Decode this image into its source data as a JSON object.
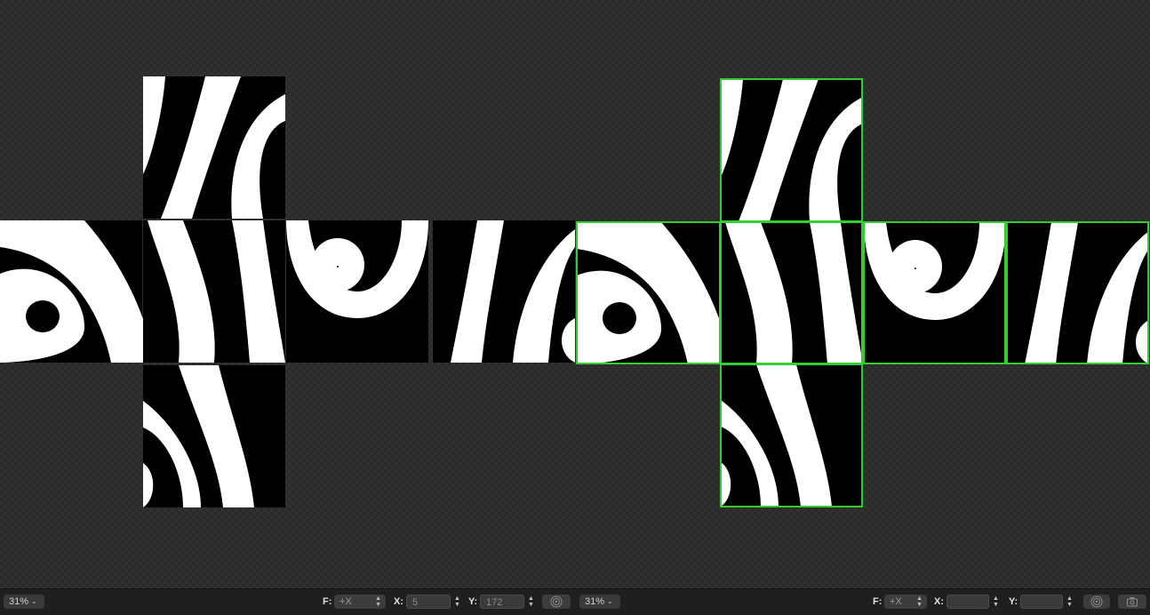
{
  "left_pane": {
    "zoom": "31%",
    "face_label": "F:",
    "face_value": "+X",
    "x_label": "X:",
    "x_value": "5",
    "y_label": "Y:",
    "y_value": "172"
  },
  "right_pane": {
    "zoom": "31%",
    "face_label": "F:",
    "face_value": "+X",
    "x_label": "X:",
    "x_value": "",
    "y_label": "Y:",
    "y_value": ""
  },
  "colors": {
    "selection_outline": "#33cc33",
    "stripe_dark": "#000000",
    "stripe_light": "#ffffff"
  },
  "icons": [
    "chevron-down-icon",
    "up-down-arrows-icon",
    "target-icon",
    "camera-icon"
  ]
}
